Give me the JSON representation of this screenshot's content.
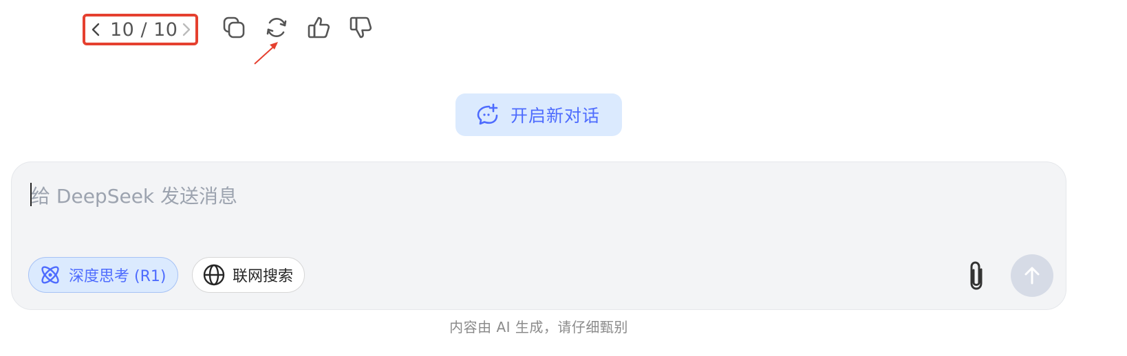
{
  "toolbar": {
    "pager_text": "10 / 10",
    "icons": {
      "prev": "chevron-left-icon",
      "next": "chevron-right-icon",
      "copy": "copy-icon",
      "regenerate": "refresh-icon",
      "like": "thumbs-up-icon",
      "dislike": "thumbs-down-icon"
    },
    "highlight_color": "#e5402f"
  },
  "new_chat": {
    "label": "开启新对话",
    "icon": "new-chat-icon"
  },
  "composer": {
    "placeholder": "给 DeepSeek 发送消息",
    "value": "",
    "deep_think_label": "深度思考 (R1)",
    "web_search_label": "联网搜索",
    "icons": {
      "deep_think": "atom-icon",
      "web_search": "globe-icon",
      "attach": "paperclip-icon",
      "send": "arrow-up-icon"
    }
  },
  "footer": {
    "disclaimer": "内容由 AI 生成，请仔细甄别"
  },
  "colors": {
    "accent": "#4d6bfe",
    "accent_bg": "#dbeafe",
    "annotation": "#e5402f"
  }
}
